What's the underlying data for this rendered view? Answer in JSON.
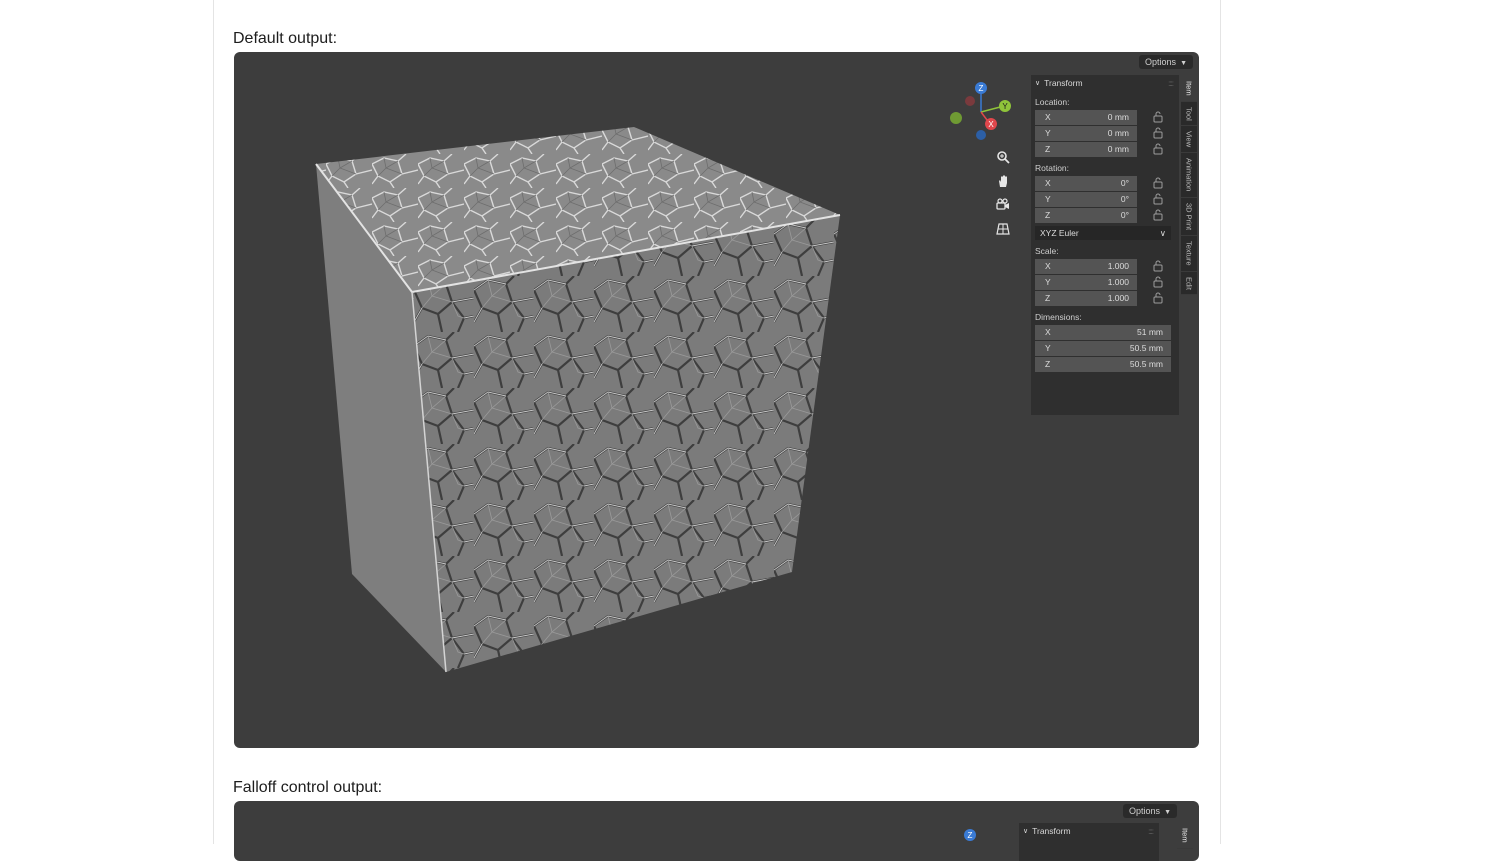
{
  "sections": {
    "default_label": "Default output:",
    "falloff_label": "Falloff control output:"
  },
  "viewport": {
    "options_label": "Options",
    "background_color": "#3d3d3d"
  },
  "gizmo": {
    "z_label": "Z",
    "y_label": "Y",
    "x_label": "X",
    "colors": {
      "z": "#3a7bd5",
      "y": "#8fc43a",
      "x": "#e0474c"
    }
  },
  "nav_tools": [
    "zoom-icon",
    "hand-icon",
    "camera-icon",
    "grid-icon"
  ],
  "transform_panel": {
    "title": "Transform",
    "location": {
      "label": "Location:",
      "rows": [
        {
          "axis": "X",
          "value": "0 mm"
        },
        {
          "axis": "Y",
          "value": "0 mm"
        },
        {
          "axis": "Z",
          "value": "0 mm"
        }
      ]
    },
    "rotation": {
      "label": "Rotation:",
      "rows": [
        {
          "axis": "X",
          "value": "0°"
        },
        {
          "axis": "Y",
          "value": "0°"
        },
        {
          "axis": "Z",
          "value": "0°"
        }
      ],
      "mode": "XYZ Euler"
    },
    "scale": {
      "label": "Scale:",
      "rows": [
        {
          "axis": "X",
          "value": "1.000"
        },
        {
          "axis": "Y",
          "value": "1.000"
        },
        {
          "axis": "Z",
          "value": "1.000"
        }
      ]
    },
    "dimensions": {
      "label": "Dimensions:",
      "rows": [
        {
          "axis": "X",
          "value": "51 mm"
        },
        {
          "axis": "Y",
          "value": "50.5 mm"
        },
        {
          "axis": "Z",
          "value": "50.5 mm"
        }
      ]
    }
  },
  "side_tabs": [
    "Item",
    "Tool",
    "View",
    "Animation",
    "3D Print",
    "Texture",
    "Edit"
  ],
  "second_viewport": {
    "options_label": "Options",
    "panel_title": "Transform",
    "z_label": "Z",
    "first_tab": "Item"
  }
}
